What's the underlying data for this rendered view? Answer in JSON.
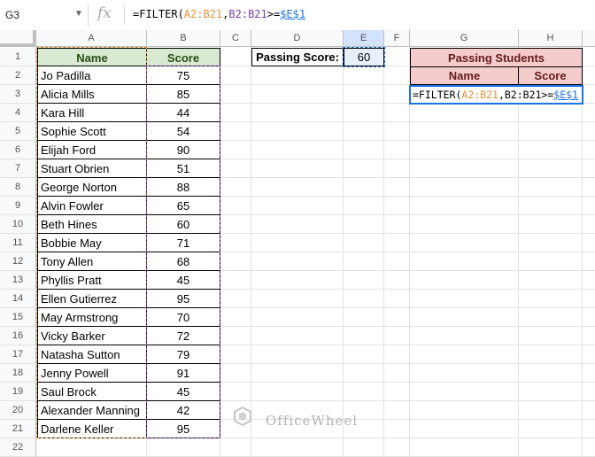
{
  "formula_bar": {
    "name_box": "G3",
    "fx_label": "fx",
    "formula_parts": [
      "=FILTER(",
      "A2:B21",
      ",",
      "B2:B21",
      ">=",
      "$E$1"
    ]
  },
  "columns": [
    "A",
    "B",
    "C",
    "D",
    "E",
    "F",
    "G",
    "H"
  ],
  "rows": [
    "1",
    "2",
    "3",
    "4",
    "5",
    "6",
    "7",
    "8",
    "9",
    "10",
    "11",
    "12",
    "13",
    "14",
    "15",
    "16",
    "17",
    "18",
    "19",
    "20",
    "21",
    "22"
  ],
  "table": {
    "headers": {
      "name": "Name",
      "score": "Score"
    },
    "rows": [
      {
        "name": "Jo Padilla",
        "score": "75"
      },
      {
        "name": "Alicia Mills",
        "score": "85"
      },
      {
        "name": "Kara Hill",
        "score": "44"
      },
      {
        "name": "Sophie Scott",
        "score": "54"
      },
      {
        "name": "Elijah Ford",
        "score": "90"
      },
      {
        "name": "Stuart Obrien",
        "score": "51"
      },
      {
        "name": "George Norton",
        "score": "88"
      },
      {
        "name": "Alvin Fowler",
        "score": "65"
      },
      {
        "name": "Beth Hines",
        "score": "60"
      },
      {
        "name": "Bobbie May",
        "score": "71"
      },
      {
        "name": "Tony Allen",
        "score": "68"
      },
      {
        "name": "Phyllis Pratt",
        "score": "45"
      },
      {
        "name": "Ellen Gutierrez",
        "score": "95"
      },
      {
        "name": "May Armstrong",
        "score": "70"
      },
      {
        "name": "Vicky Barker",
        "score": "72"
      },
      {
        "name": "Natasha Sutton",
        "score": "79"
      },
      {
        "name": "Jenny Powell",
        "score": "91"
      },
      {
        "name": "Saul Brock",
        "score": "45"
      },
      {
        "name": "Alexander Manning",
        "score": "42"
      },
      {
        "name": "Darlene Keller",
        "score": "95"
      }
    ]
  },
  "passing": {
    "label": "Passing Score:",
    "value": "60"
  },
  "output": {
    "title": "Passing Students",
    "name_header": "Name",
    "score_header": "Score"
  },
  "editing_cell_formula_parts": [
    "=FILTER(",
    "A2:B21",
    ",",
    "B2:B21",
    ">=",
    "$E$1"
  ],
  "watermark": "OfficeWheel",
  "colors": {
    "orange_range": "#e69138",
    "purple_range": "#7b3fa6",
    "blue_ref": "#1a73e8",
    "green_header": "#d9ead3",
    "red_header": "#f4cccc"
  }
}
